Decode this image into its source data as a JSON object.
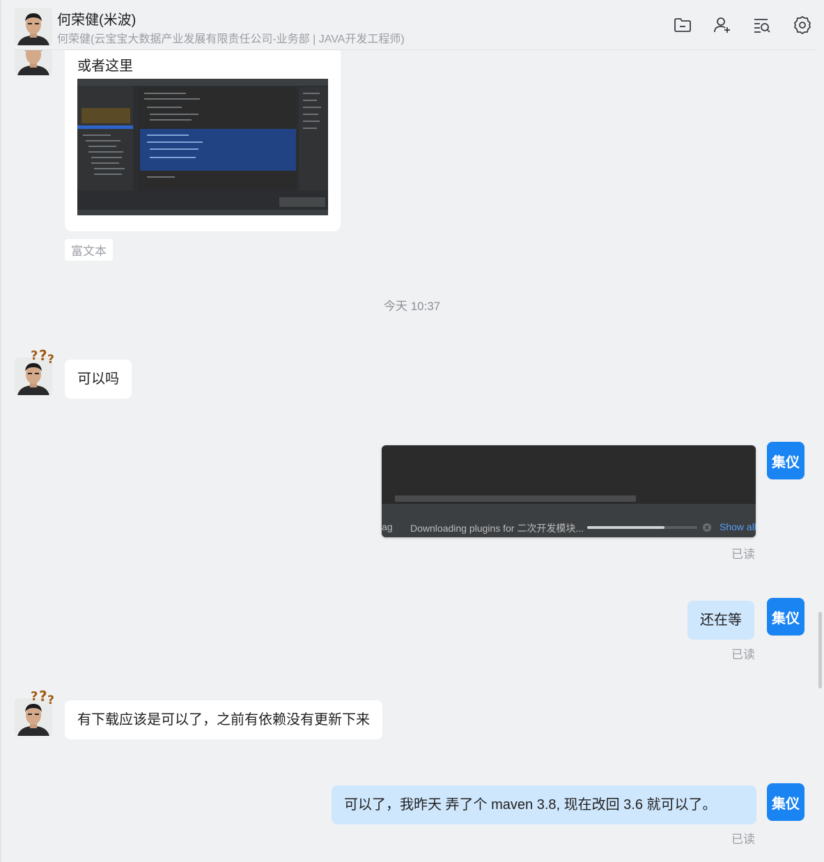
{
  "header": {
    "title": "何荣健(米波)",
    "subtitle": "何荣健(云宝宝大数据产业发展有限责任公司-业务部 | JAVA开发工程师)",
    "icons": [
      "folder-minus-icon",
      "add-user-icon",
      "search-list-icon",
      "settings-gear-icon"
    ]
  },
  "messages": {
    "m1": {
      "text": "或者这里",
      "tag": "富文本"
    },
    "time_divider": "今天 10:37",
    "m2": {
      "text": "可以吗"
    },
    "m3": {
      "progress_text": "Downloading plugins for 二次开发模块...",
      "show_all": "Show all",
      "left_cut": "ag",
      "progress": 0.7,
      "read": "已读"
    },
    "m4": {
      "text": "还在等",
      "read": "已读"
    },
    "m5": {
      "text": "有下载应该是可以了，之前有依赖没有更新下来"
    },
    "m6": {
      "text": "可以了，我昨天 弄了个  maven 3.8, 现在改回 3.6 就可以了。",
      "read": "已读"
    }
  },
  "me": {
    "avatar_text": "集仪"
  },
  "colors": {
    "accent": "#1a84f3",
    "my_bubble": "#cfe7fd",
    "bg": "#f0f1f3"
  }
}
